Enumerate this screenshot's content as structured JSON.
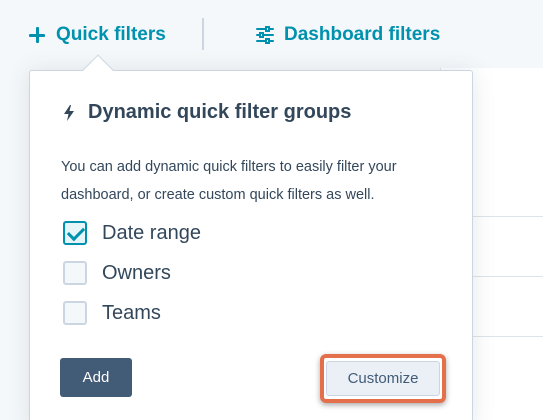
{
  "topbar": {
    "quick_filters_label": "Quick filters",
    "dashboard_filters_label": "Dashboard filters"
  },
  "popover": {
    "title": "Dynamic quick filter groups",
    "description": "You can add dynamic quick filters to easily filter your dashboard, or create custom quick filters as well.",
    "options": [
      {
        "label": "Date range",
        "checked": true
      },
      {
        "label": "Owners",
        "checked": false
      },
      {
        "label": "Teams",
        "checked": false
      }
    ],
    "add_label": "Add",
    "customize_label": "Customize"
  },
  "colors": {
    "accent": "#0091ae",
    "primary_button": "#425b76",
    "highlight": "#e36f4b"
  },
  "icons": {
    "quick_filters": "plus-icon",
    "dashboard_filters": "sliders-icon",
    "title": "lightning-icon"
  }
}
